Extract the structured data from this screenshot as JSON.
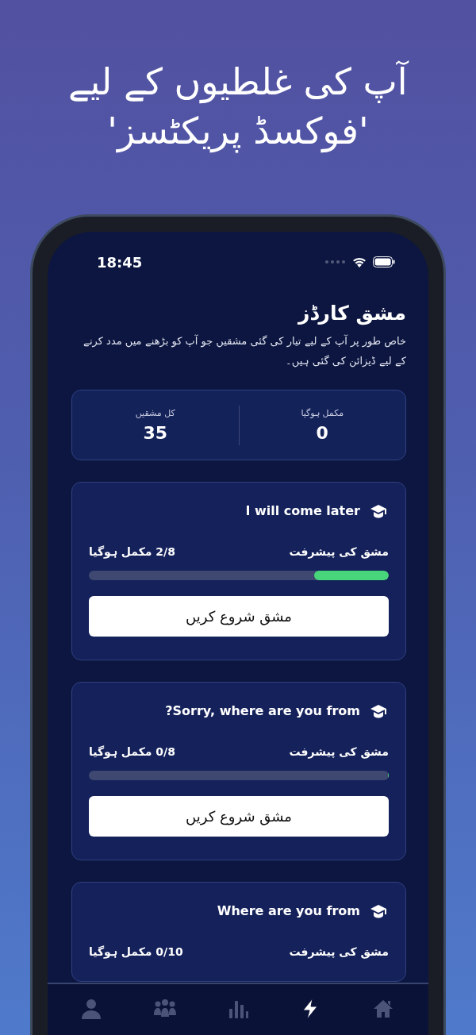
{
  "headline": "آپ کی غلطیوں کے لیے\n'فوکسڈ پریکٹسز'",
  "status_bar": {
    "time": "18:45"
  },
  "page": {
    "title": "مشق کارڈز",
    "description": "خاص طور پر آپ کے لیے تیار کی گئی مشقیں جو آپ کو بڑھنے میں مدد کرنے کے لیے ڈیزائن کی گئی ہیں۔"
  },
  "stats": [
    {
      "label": "مکمل ہوگیا",
      "value": "0"
    },
    {
      "label": "کل مشقیں",
      "value": "35"
    }
  ],
  "cards": [
    {
      "title": "I will come later",
      "progress_label": "مشق کی پیشرفت",
      "progress_text": "2/8 مکمل ہوگیا",
      "level": 0.25,
      "button": "مشق شروع کریں"
    },
    {
      "title": "Sorry, where are you from?",
      "progress_label": "مشق کی پیشرفت",
      "progress_text": "0/8 مکمل ہوگیا",
      "level": 0,
      "button": "مشق شروع کریں"
    },
    {
      "title": "Where are you from",
      "progress_label": "مشق کی پیشرفت",
      "progress_text": "0/10 مکمل ہوگیا"
    }
  ],
  "tabs": [
    {
      "kind": "home",
      "selected": false
    },
    {
      "kind": "practice",
      "selected": true
    },
    {
      "kind": "stats",
      "selected": false
    },
    {
      "kind": "community",
      "selected": false
    },
    {
      "kind": "profile",
      "selected": false
    }
  ]
}
